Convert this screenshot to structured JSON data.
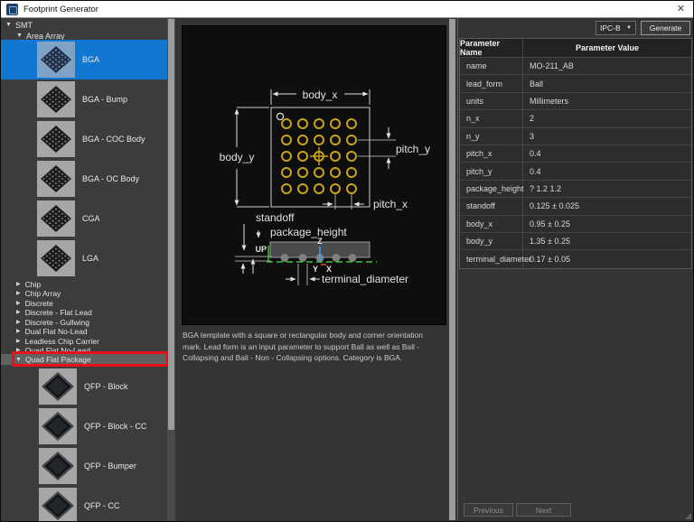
{
  "window": {
    "title": "Footprint Generator",
    "close_glyph": "✕"
  },
  "icons": {
    "expanded": "▼",
    "collapsed": "▶"
  },
  "toolbar": {
    "ipc_selected": "IPC-B",
    "dropdown_caret": "▼",
    "generate_label": "Generate"
  },
  "tree": {
    "root_label": "SMT",
    "group_label": "Area Array",
    "area_array_items": [
      {
        "label": "BGA",
        "selected": true
      },
      {
        "label": "BGA - Bump"
      },
      {
        "label": "BGA - COC Body"
      },
      {
        "label": "BGA - OC Body"
      },
      {
        "label": "CGA"
      },
      {
        "label": "LGA"
      }
    ],
    "collapsed_items": [
      "Chip",
      "Chip Array",
      "Discrete",
      "Discrete - Flat Lead",
      "Discrete - Gullwing",
      "Dual Flat No-Lead",
      "Leadless Chip Carrier",
      "Quad Flat No-Lead"
    ],
    "expanded_group_label": "Quad Flat Package",
    "qfp_items": [
      "QFP - Block",
      "QFP - Block - CC",
      "QFP - Bumper",
      "QFP - CC"
    ]
  },
  "diagram": {
    "labels": {
      "body_x": "body_x",
      "body_y": "body_y",
      "pitch_y": "pitch_y",
      "pitch_x": "pitch_x",
      "standoff": "standoff",
      "package_height": "package_height",
      "terminal_diameter": "terminal_diameter",
      "up": "UP",
      "axis_z": "Z",
      "axis_y": "Y",
      "axis_x": "X"
    },
    "description": "BGA template with a square or rectangular body and corner orientation mark. Lead form is an input parameter to support Ball as well as Ball - Collapsing and Ball - Non - Collapsing options. Category is BGA."
  },
  "table": {
    "headers": [
      "Parameter Name",
      "Parameter Value"
    ],
    "rows": [
      {
        "param": "name",
        "value": "MO-211_AB"
      },
      {
        "param": "lead_form",
        "value": "Ball"
      },
      {
        "param": "units",
        "value": "Millimeters"
      },
      {
        "param": "n_x",
        "value": "2"
      },
      {
        "param": "n_y",
        "value": "3"
      },
      {
        "param": "pitch_x",
        "value": "0.4"
      },
      {
        "param": "pitch_y",
        "value": "0.4"
      },
      {
        "param": "package_height",
        "value": "? 1.2 1.2"
      },
      {
        "param": "standoff",
        "value": "0.125 ± 0.025"
      },
      {
        "param": "body_x",
        "value": "0.95 ± 0.25"
      },
      {
        "param": "body_y",
        "value": "1.35 ± 0.25"
      },
      {
        "param": "terminal_diameter",
        "value": "0.17 ± 0.05"
      }
    ]
  },
  "footer": {
    "previous_label": "Previous",
    "next_label": "Next"
  },
  "colors": {
    "selection_blue": "#1177d1",
    "annotation_red": "#e8101c",
    "pad_yellow": "#c8a415",
    "board_green": "#3ebf3e",
    "axis_z_blue": "#3da1ff",
    "axis_x_red": "#e04a2f"
  }
}
